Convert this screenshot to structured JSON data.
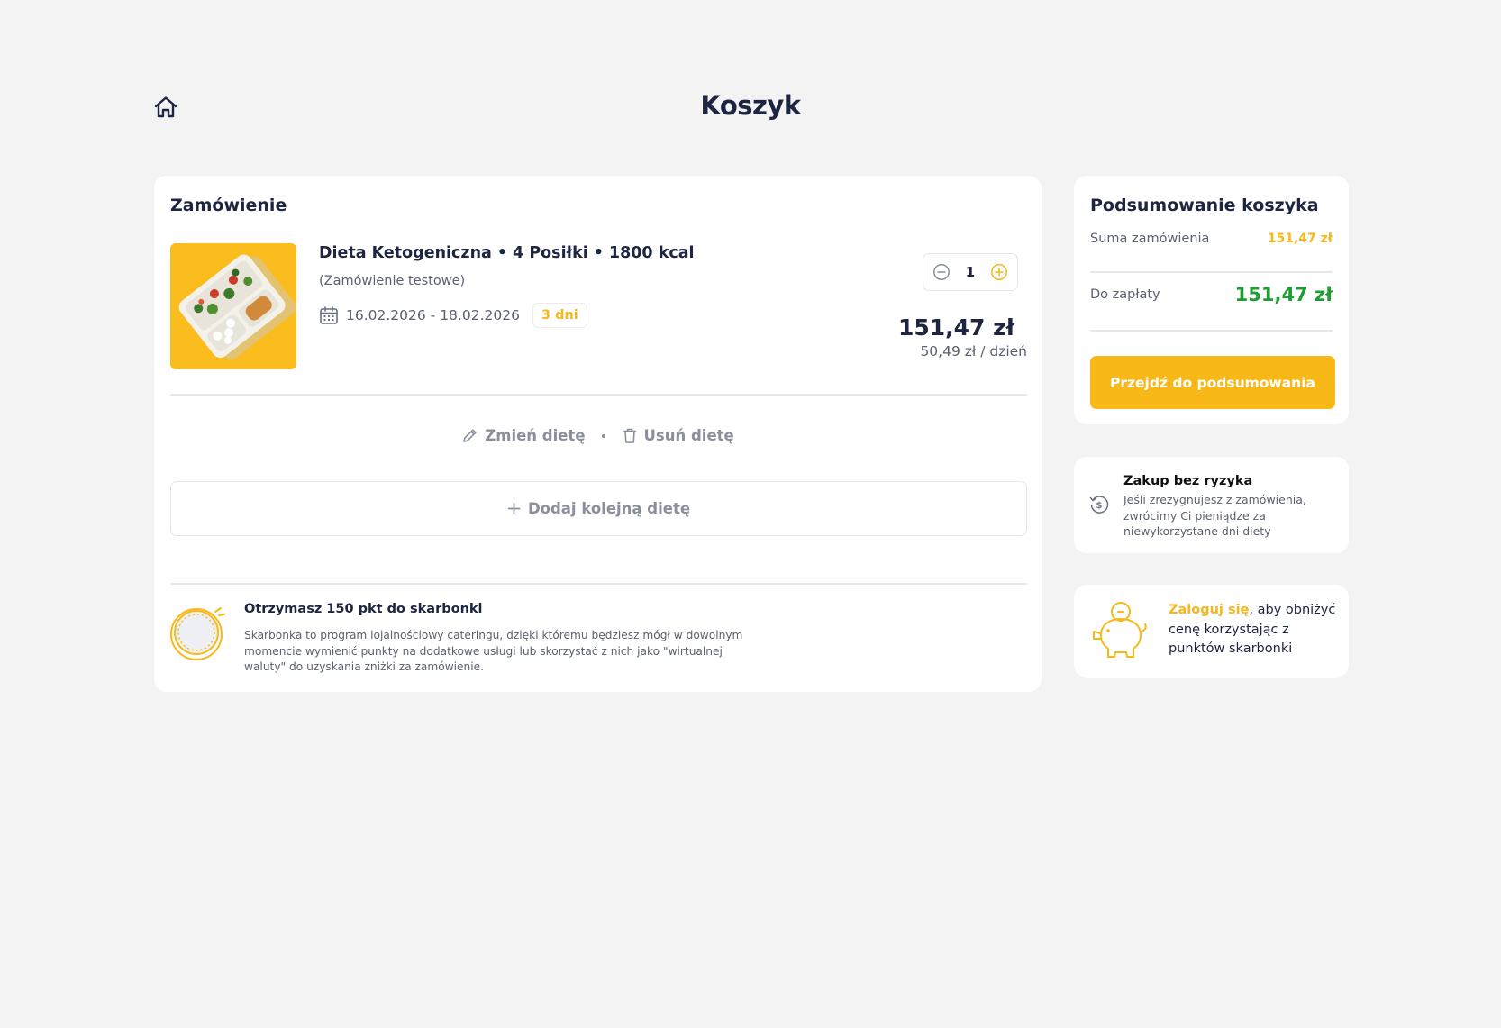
{
  "header": {
    "title": "Koszyk",
    "home_icon": "home-icon"
  },
  "order": {
    "heading": "Zamówienie",
    "item": {
      "name": "Dieta Ketogeniczna",
      "meals": "4 Posiłki",
      "kcal": "1800 kcal",
      "separator": "•",
      "note": "(Zamówienie testowe)",
      "date_range": "16.02.2026 - 18.02.2026",
      "days": "3 dni",
      "quantity": "1",
      "price": "151,47 zł",
      "price_per_day": "50,49 zł / dzień"
    },
    "actions": {
      "change": "Zmień dietę",
      "remove": "Usuń dietę"
    },
    "add_diet": "Dodaj kolejną dietę",
    "points": {
      "title": "Otrzymasz 150 pkt do skarbonki",
      "description": "Skarbonka to program lojalnościowy cateringu, dzięki któremu będziesz mógł w dowolnym momencie wymienić punkty na dodatkowe usługi lub skorzystać z nich jako \"wirtualnej waluty\" do uzyskania zniżki za zamówienie."
    }
  },
  "summary": {
    "heading": "Podsumowanie koszyka",
    "order_total_label": "Suma zamówienia",
    "order_total_value": "151,47 zł",
    "to_pay_label": "Do zapłaty",
    "to_pay_value": "151,47 zł",
    "cta": "Przejdź do podsumowania"
  },
  "risk_free": {
    "title": "Zakup bez ryzyka",
    "description": "Jeśli zrezygnujesz z zamówienia, zwrócimy Ci pieniądze za niewykorzystane dni diety"
  },
  "login_promo": {
    "link": "Zaloguj się",
    "text": ", aby obniżyć cenę korzystając z punktów skarbonki"
  },
  "colors": {
    "accent": "#f8b818",
    "success": "#1f9d35",
    "text": "#1d2540",
    "background": "#f3f3f3"
  }
}
